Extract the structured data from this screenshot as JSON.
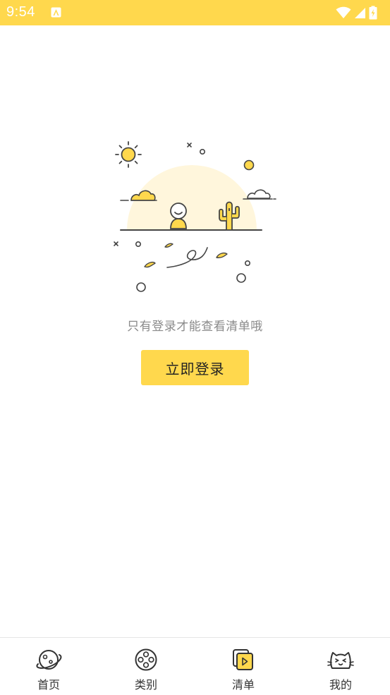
{
  "status_bar": {
    "time": "9:54",
    "background_color": "#FFD84D",
    "icons": [
      "notification-a-icon",
      "wifi-icon",
      "signal-icon",
      "battery-charging-icon"
    ]
  },
  "empty_state": {
    "illustration": "empty-desert-illustration",
    "message": "只有登录才能查看清单哦",
    "login_button_label": "立即登录",
    "accent_color": "#FFD84D"
  },
  "tab_bar": {
    "tabs": [
      {
        "label": "首页",
        "icon": "planet-icon",
        "active": false
      },
      {
        "label": "类别",
        "icon": "film-reel-icon",
        "active": false
      },
      {
        "label": "清单",
        "icon": "playlist-icon",
        "active": true
      },
      {
        "label": "我的",
        "icon": "cat-face-icon",
        "active": false
      }
    ]
  }
}
